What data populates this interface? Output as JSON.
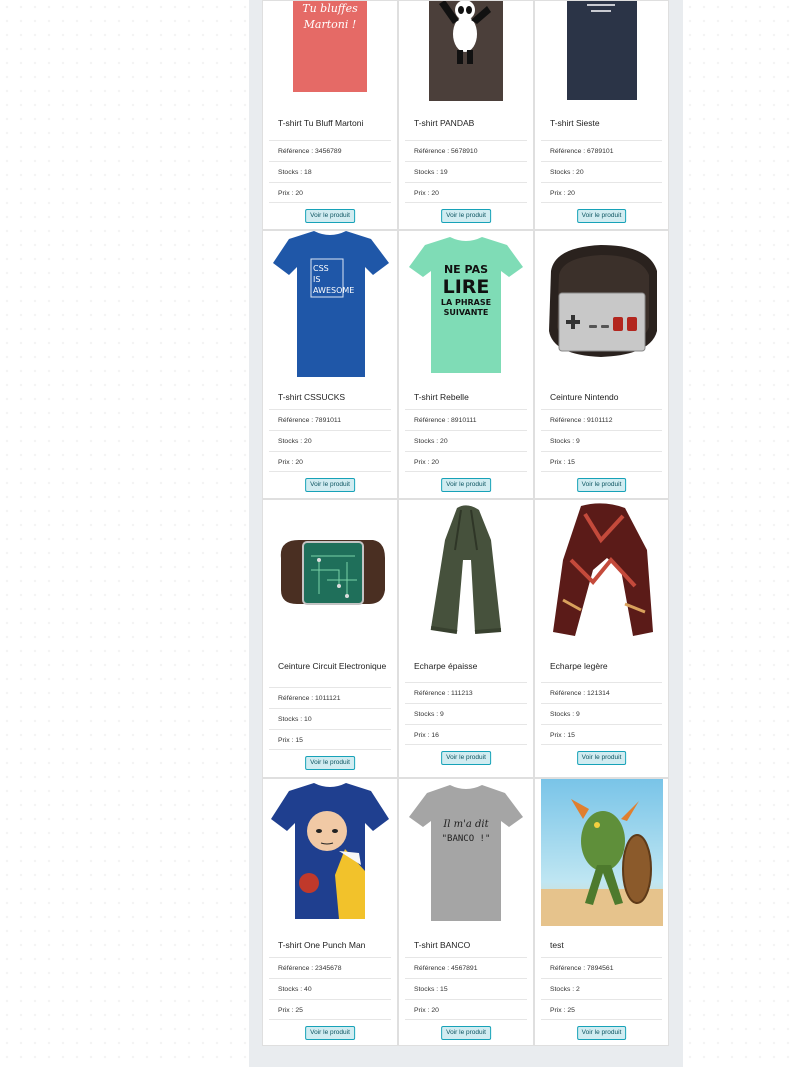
{
  "colors": {
    "panel": "#e9ecef",
    "button_bg": "#d1ecf1",
    "button_border": "#17a2b8",
    "button_text": "#0c5460"
  },
  "products": [
    {
      "name": "T-shirt Tu Bluff Martoni",
      "reference": "Référence : 3456789",
      "stocks": "Stocks : 18",
      "prix": "Prix : 20",
      "button": "Voir le produit",
      "print_text": "Tu bluffes Martoni !"
    },
    {
      "name": "T-shirt PANDAB",
      "reference": "Référence : 5678910",
      "stocks": "Stocks : 19",
      "prix": "Prix : 20",
      "button": "Voir le produit"
    },
    {
      "name": "T-shirt Sieste",
      "reference": "Référence : 6789101",
      "stocks": "Stocks : 20",
      "prix": "Prix : 20",
      "button": "Voir le produit"
    },
    {
      "name": "T-shirt CSSUCKS",
      "reference": "Référence : 7891011",
      "stocks": "Stocks : 20",
      "prix": "Prix : 20",
      "button": "Voir le produit",
      "print_text": [
        "CSS",
        "IS",
        "AWESOME"
      ]
    },
    {
      "name": "T-shirt Rebelle",
      "reference": "Référence : 8910111",
      "stocks": "Stocks : 20",
      "prix": "Prix : 20",
      "button": "Voir le produit",
      "print_text": [
        "NE PAS",
        "LIRE",
        "LA PHRASE",
        "SUIVANTE"
      ]
    },
    {
      "name": "Ceinture Nintendo",
      "reference": "Référence : 9101112",
      "stocks": "Stocks : 9",
      "prix": "Prix : 15",
      "button": "Voir le produit"
    },
    {
      "name": "Ceinture Circuit Electronique",
      "reference": "Référence : 1011121",
      "stocks": "Stocks : 10",
      "prix": "Prix : 15",
      "button": "Voir le produit"
    },
    {
      "name": "Echarpe épaisse",
      "reference": "Référence : 111213",
      "stocks": "Stocks : 9",
      "prix": "Prix : 16",
      "button": "Voir le produit"
    },
    {
      "name": "Echarpe legère",
      "reference": "Référence : 121314",
      "stocks": "Stocks : 9",
      "prix": "Prix : 15",
      "button": "Voir le produit"
    },
    {
      "name": "T-shirt One Punch Man",
      "reference": "Référence : 2345678",
      "stocks": "Stocks : 40",
      "prix": "Prix : 25",
      "button": "Voir le produit"
    },
    {
      "name": "T-shirt BANCO",
      "reference": "Référence : 4567891",
      "stocks": "Stocks : 15",
      "prix": "Prix : 20",
      "button": "Voir le produit",
      "print_text": [
        "Il m'a dit",
        "\"BANCO !\""
      ]
    },
    {
      "name": "test",
      "reference": "Référence : 7894561",
      "stocks": "Stocks : 2",
      "prix": "Prix : 25",
      "button": "Voir le produit"
    }
  ]
}
